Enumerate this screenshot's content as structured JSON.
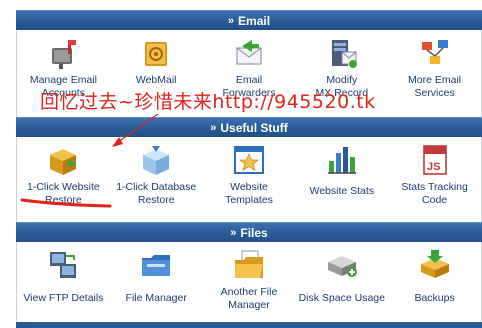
{
  "sections": {
    "email": {
      "title": "Email",
      "items": [
        {
          "label": "Manage Email\nAccounts",
          "icon": "mailbox-icon"
        },
        {
          "label": "WebMail",
          "icon": "webmail-icon"
        },
        {
          "label": "Email\nForwarders",
          "icon": "forwarder-icon"
        },
        {
          "label": "Modify\nMX Record",
          "icon": "mx-record-icon"
        },
        {
          "label": "More Email\nServices",
          "icon": "email-services-icon"
        }
      ]
    },
    "useful": {
      "title": "Useful Stuff",
      "items": [
        {
          "label": "1-Click Website\nRestore",
          "icon": "box-icon"
        },
        {
          "label": "1-Click Database\nRestore",
          "icon": "database-box-icon"
        },
        {
          "label": "Website\nTemplates",
          "icon": "template-icon"
        },
        {
          "label": "Website Stats",
          "icon": "stats-icon"
        },
        {
          "label": "Stats Tracking\nCode",
          "icon": "js-icon"
        }
      ]
    },
    "files": {
      "title": "Files",
      "items": [
        {
          "label": "View FTP Details",
          "icon": "ftp-icon"
        },
        {
          "label": "File Manager",
          "icon": "folder-icon"
        },
        {
          "label": "Another File\nManager",
          "icon": "folder-open-icon"
        },
        {
          "label": "Disk Space Usage",
          "icon": "disk-icon"
        },
        {
          "label": "Backups",
          "icon": "backup-icon"
        }
      ]
    }
  },
  "header_arrow": "»",
  "watermark": "回忆过去~珍惜未来http://945520.tk",
  "colors": {
    "header_bg": "#2a5a94",
    "label_text": "#1c3e6b",
    "annotation_red": "#e2231a"
  }
}
